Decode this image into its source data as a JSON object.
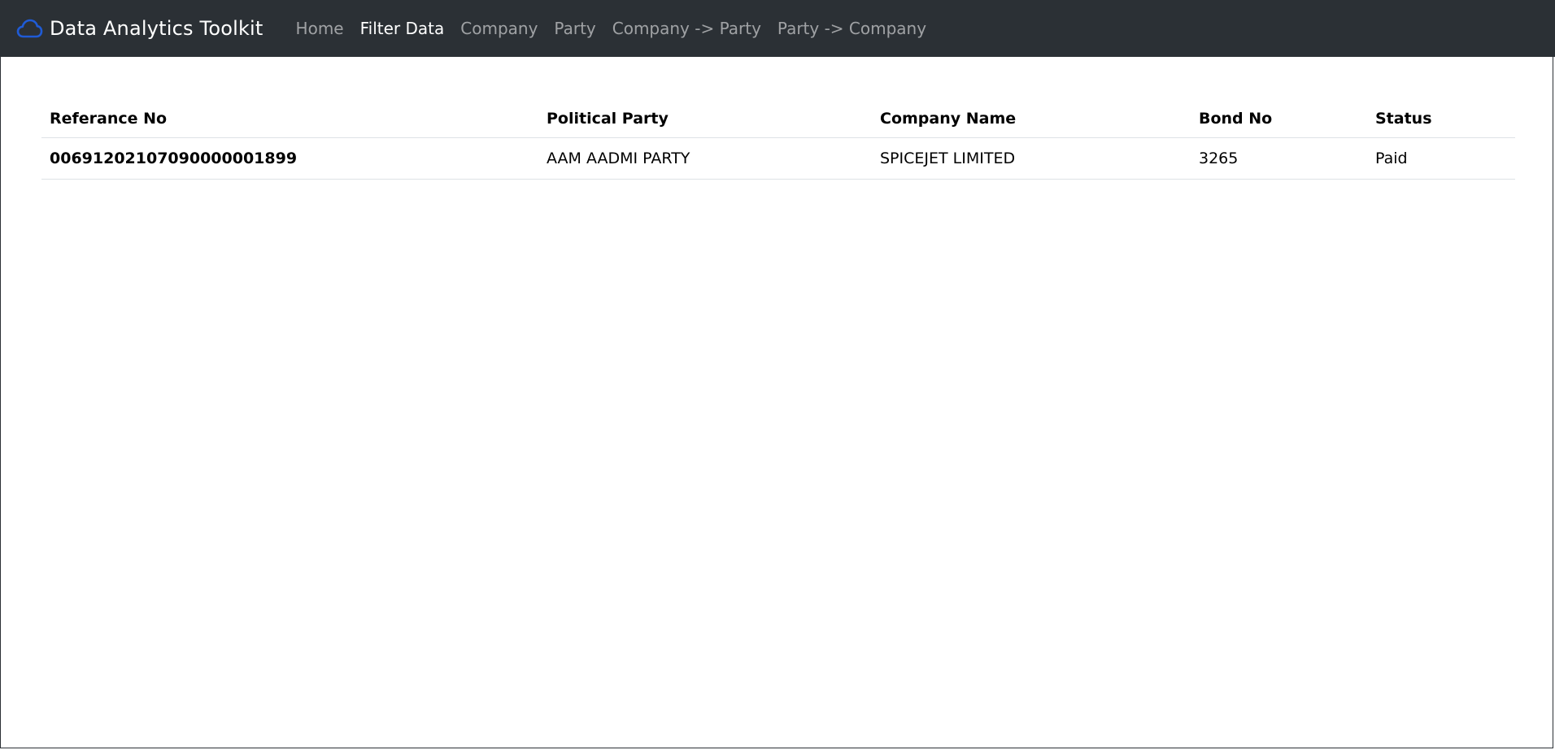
{
  "navbar": {
    "brand": {
      "icon": "cloud-icon",
      "title": "Data Analytics Toolkit",
      "icon_color": "#1f5bd6"
    },
    "links": [
      {
        "label": "Home",
        "active": false
      },
      {
        "label": "Filter Data",
        "active": true
      },
      {
        "label": "Company",
        "active": false
      },
      {
        "label": "Party",
        "active": false
      },
      {
        "label": "Company -> Party",
        "active": false
      },
      {
        "label": "Party -> Company",
        "active": false
      }
    ]
  },
  "table": {
    "headers": [
      "Referance No",
      "Political Party",
      "Company Name",
      "Bond No",
      "Status"
    ],
    "rows": [
      [
        "00691202107090000001899",
        "AAM AADMI PARTY",
        "SPICEJET LIMITED",
        "3265",
        "Paid"
      ]
    ]
  },
  "colors": {
    "navbar_bg": "#2b3035",
    "link_inactive": "rgba(255,255,255,0.55)",
    "link_active": "#ffffff",
    "table_border": "#dee2e6"
  }
}
